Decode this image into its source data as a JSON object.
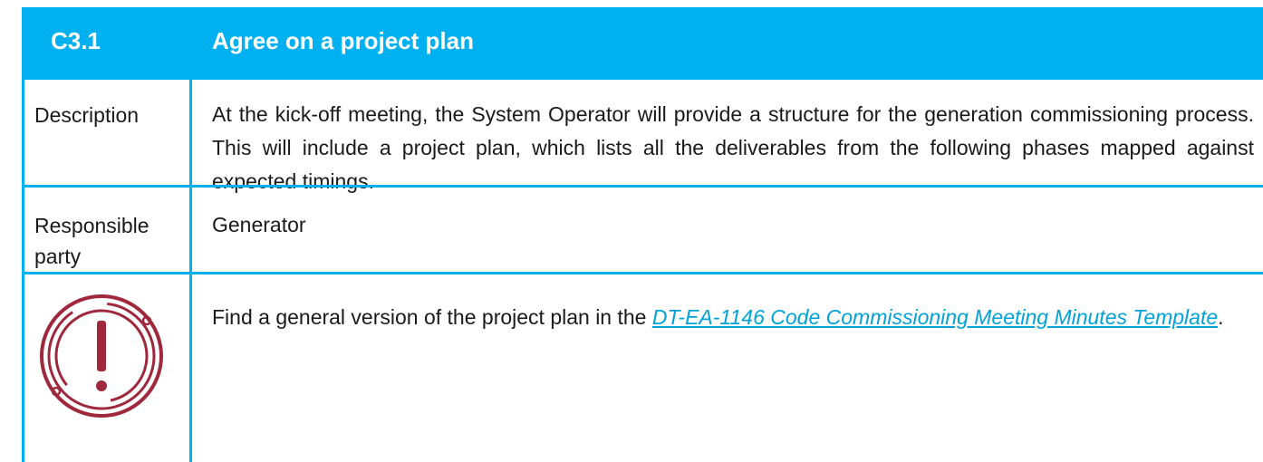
{
  "header": {
    "number": "C3.1",
    "title": "Agree on a project plan"
  },
  "rows": {
    "description": {
      "label": "Description",
      "text": "At the kick-off meeting, the System Operator will provide a structure for the generation commissioning process. This will include a project plan, which lists all the deliverables from the following phases mapped against expected timings."
    },
    "responsible": {
      "label_line1": "Responsible",
      "label_line2": "party",
      "value": "Generator"
    },
    "note": {
      "icon": "exclamation-circle-icon",
      "text_before": "Find a general version of the project plan in the ",
      "link_text": "DT-EA-1146 Code Commissioning Meeting Minutes Template",
      "text_after": "."
    }
  },
  "colors": {
    "accent": "#00b0f0",
    "icon": "#a0283d",
    "link": "#00a3d9"
  }
}
